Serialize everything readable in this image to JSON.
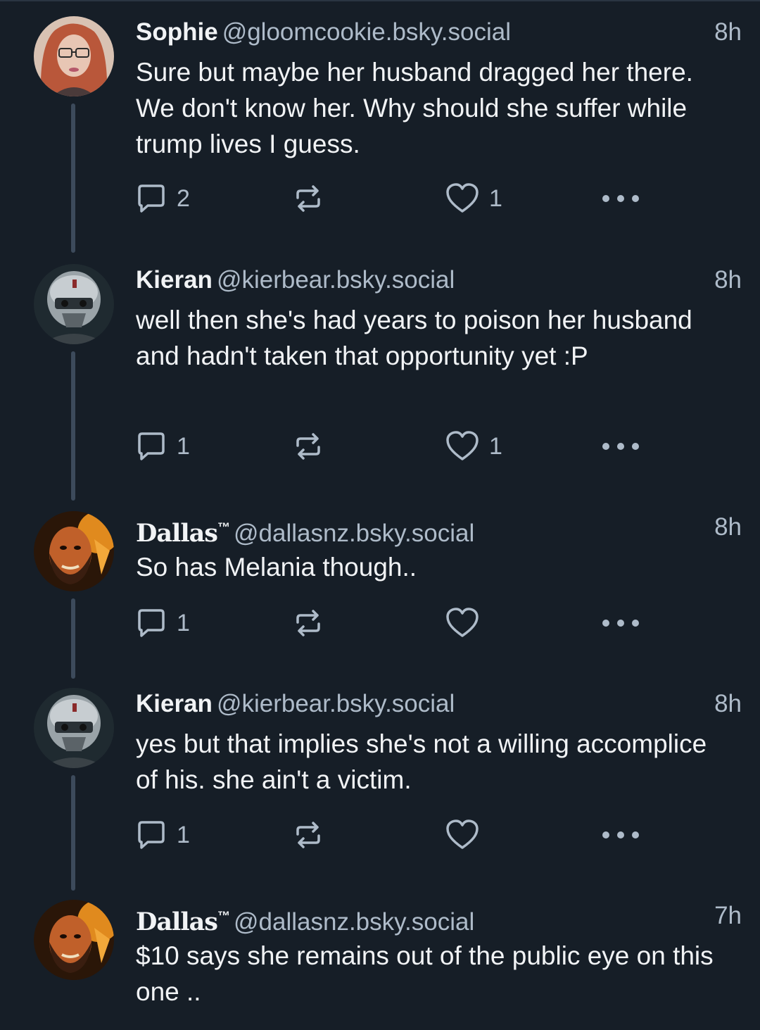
{
  "posts": [
    {
      "name": "Sophie",
      "trademark": "",
      "handle": "@gloomcookie.bsky.social",
      "time": "8h",
      "text": "Sure but maybe her husband dragged her there. We don't know her. Why should she suffer while trump lives I guess.",
      "reply_count": "2",
      "like_count": "1"
    },
    {
      "name": "Kieran",
      "trademark": "",
      "handle": "@kierbear.bsky.social",
      "time": "8h",
      "text": "well then she's had years to poison her husband and hadn't taken that opportunity yet :P",
      "reply_count": "1",
      "like_count": "1"
    },
    {
      "name": "Dallas",
      "trademark": "™",
      "handle": "@dallasnz.bsky.social",
      "time": "8h",
      "text": "So has Melania though..",
      "reply_count": "1",
      "like_count": ""
    },
    {
      "name": "Kieran",
      "trademark": "",
      "handle": "@kierbear.bsky.social",
      "time": "8h",
      "text": "yes but that implies she's not a willing accomplice of his. she ain't a victim.",
      "reply_count": "1",
      "like_count": ""
    },
    {
      "name": "Dallas",
      "trademark": "™",
      "handle": "@dallasnz.bsky.social",
      "time": "7h",
      "text": "$10 says she remains out of the public eye on this one .."
    }
  ],
  "icons": {
    "reply": "reply-bubble-icon",
    "repost": "repost-arrows-icon",
    "like": "heart-icon",
    "more": "more-dots-icon"
  },
  "colors": {
    "background": "#161e27",
    "thread_line": "#3c4a5b",
    "muted_text": "#aebbc9",
    "primary_text": "#f1f3f5"
  }
}
